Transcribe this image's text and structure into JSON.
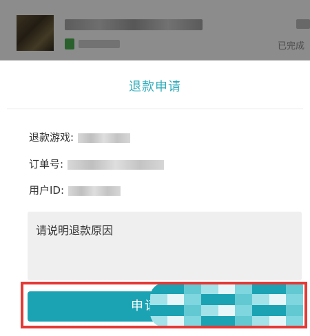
{
  "order": {
    "status": "已完成"
  },
  "dialog": {
    "title": "退款申请",
    "fields": {
      "game_label": "退款游戏:",
      "order_label": "订单号:",
      "user_label": "用户ID:"
    },
    "reason_placeholder": "请说明退款原因",
    "submit_label": "申请"
  },
  "colors": {
    "accent": "#2eaab9",
    "button": "#1ba3b4",
    "highlight": "#e53935"
  }
}
